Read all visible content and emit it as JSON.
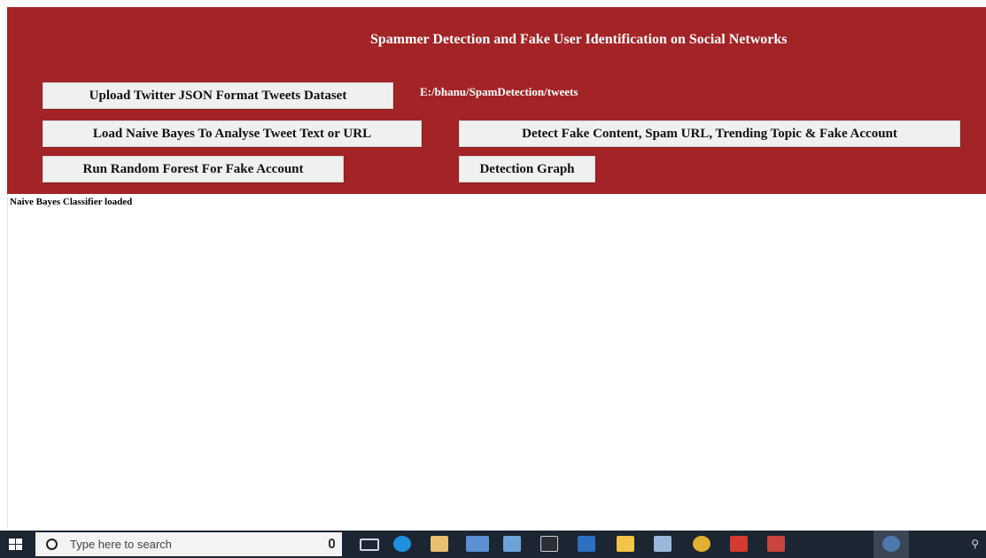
{
  "app": {
    "title": "Spammer Detection and Fake User Identification on Social Networks",
    "dataset_path": "E:/bhanu/SpamDetection/tweets",
    "output_text": "Naive Bayes Classifier loaded"
  },
  "buttons": {
    "upload": "Upload Twitter JSON Format Tweets Dataset",
    "naive_bayes": "Load Naive Bayes To Analyse Tweet Text or URL",
    "detect": "Detect Fake Content, Spam URL, Trending Topic & Fake Account",
    "random_forest": "Run Random Forest For Fake Account",
    "graph": "Detection Graph"
  },
  "taskbar": {
    "search_placeholder": "Type here to search",
    "icons": [
      "task-view-icon",
      "edge-icon",
      "store-icon",
      "mail-icon",
      "app-icon",
      "terminal-icon",
      "word-icon",
      "file-explorer-icon",
      "document-icon",
      "chrome-icon",
      "acrobat-icon",
      "app-red-icon",
      "python-icon"
    ]
  },
  "colors": {
    "header_bg": "#a32426",
    "button_bg": "#f0f0f0",
    "taskbar_bg": "#1c2532"
  }
}
